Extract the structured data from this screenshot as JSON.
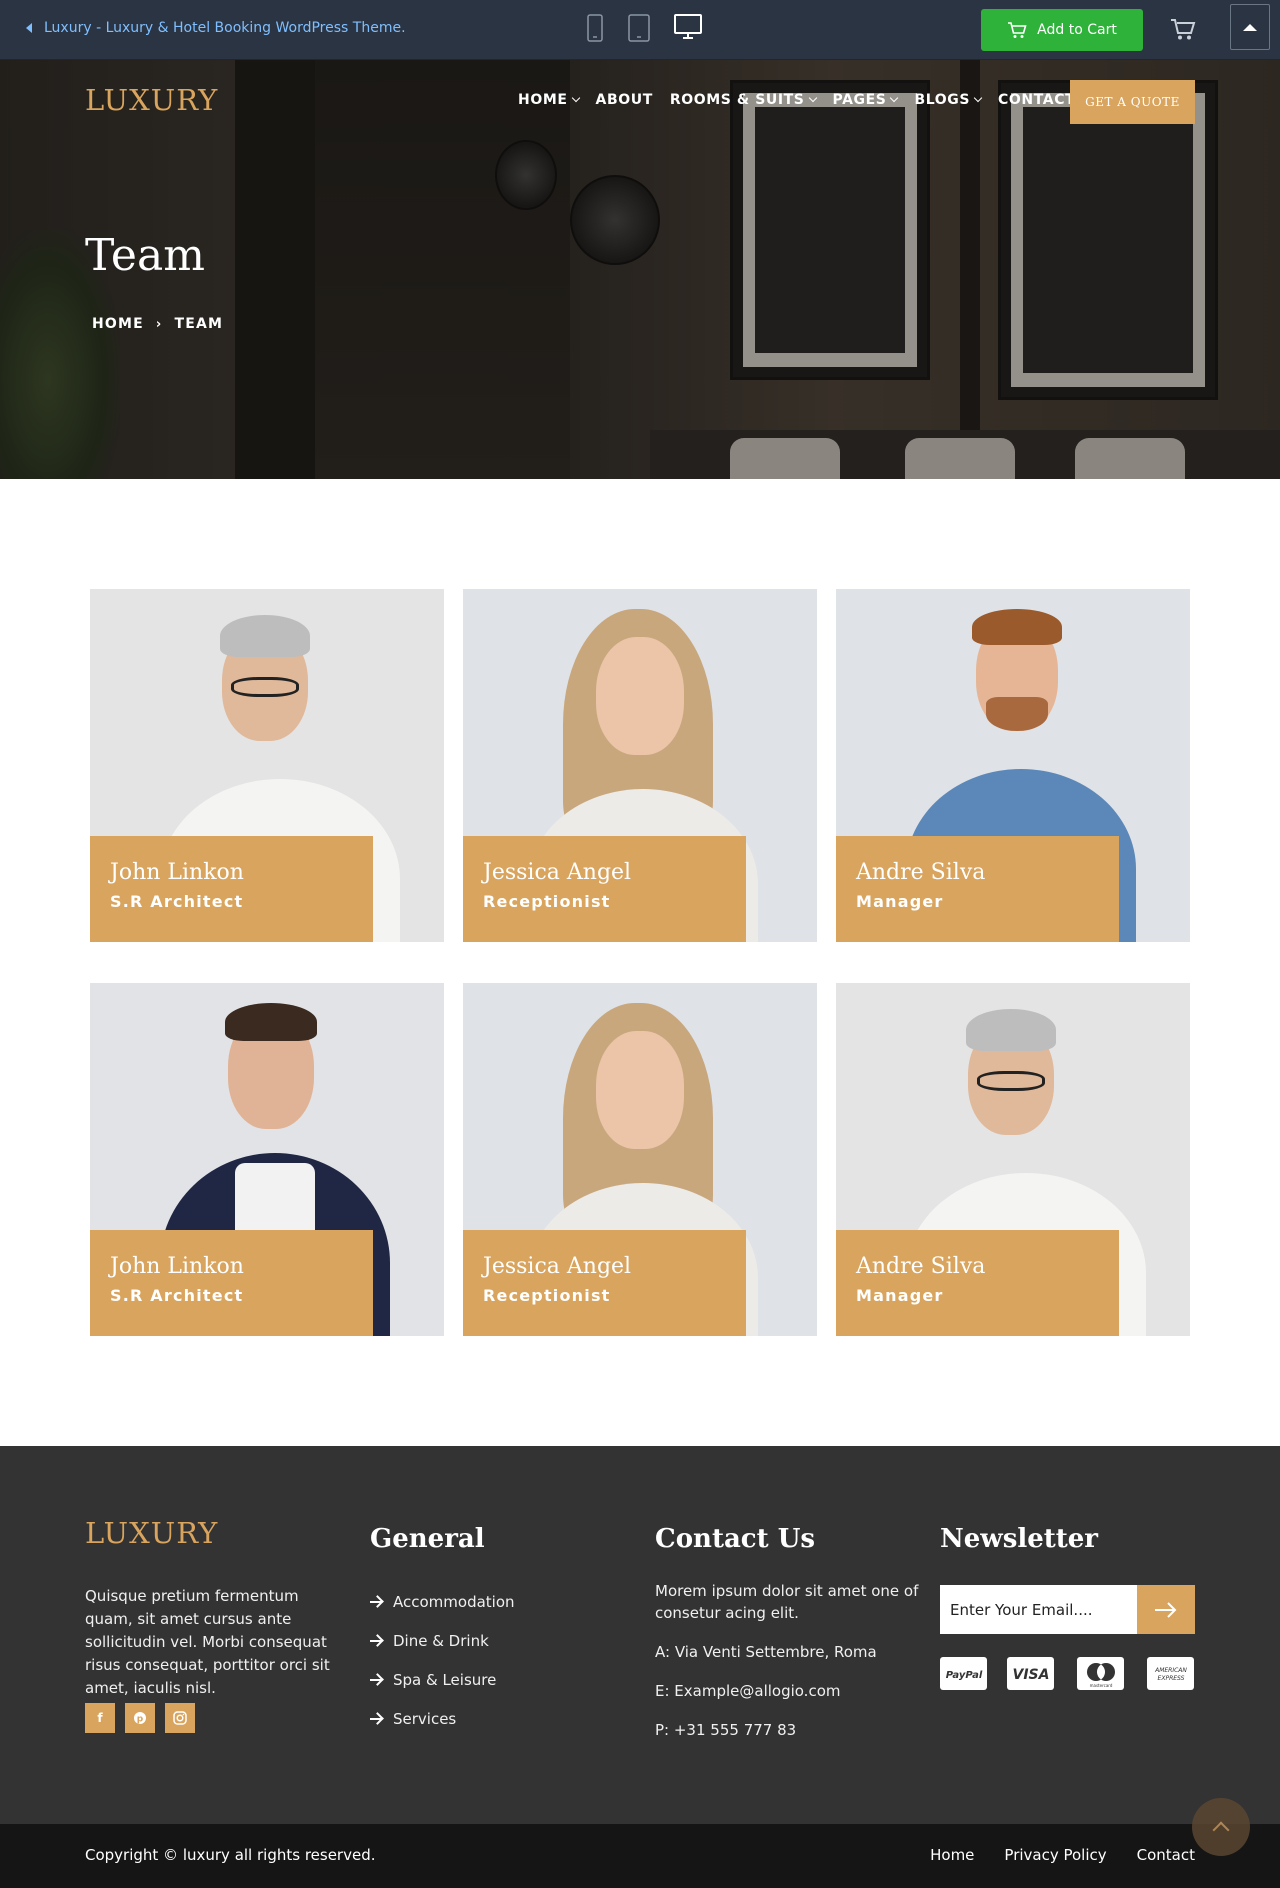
{
  "preview_bar": {
    "back_link": "Luxury - Luxury & Hotel Booking WordPress Theme.",
    "add_to_cart": "Add to Cart",
    "icons": [
      "mobile-icon",
      "tablet-icon",
      "desktop-icon",
      "cart-icon",
      "collapse-icon"
    ]
  },
  "header": {
    "logo": "LUXURY",
    "nav": [
      "HOME",
      "ABOUT",
      "ROOMS & SUITS",
      "PAGES",
      "BLOGS",
      "CONTACT"
    ],
    "quote_button": "GET A QUOTE"
  },
  "hero": {
    "title": "Team",
    "breadcrumb": [
      "HOME",
      "TEAM"
    ]
  },
  "team": [
    {
      "name": "John Linkon",
      "role": "S.R Architect"
    },
    {
      "name": "Jessica Angel",
      "role": "Receptionist"
    },
    {
      "name": "Andre Silva",
      "role": "Manager"
    },
    {
      "name": "John Linkon",
      "role": "S.R Architect"
    },
    {
      "name": "Jessica Angel",
      "role": "Receptionist"
    },
    {
      "name": "Andre Silva",
      "role": "Manager"
    }
  ],
  "footer": {
    "logo": "LUXURY",
    "about": "Quisque pretium fermentum quam, sit amet cursus ante sollicitudin vel. Morbi consequat risus consequat, porttitor orci sit amet, iaculis nisl.",
    "social": [
      "facebook-icon",
      "pinterest-icon",
      "instagram-icon"
    ],
    "general_title": "General",
    "general_links": [
      "Accommodation",
      "Dine & Drink",
      "Spa & Leisure",
      "Services"
    ],
    "contact_title": "Contact Us",
    "contact_text": "Morem ipsum dolor sit amet one of consetur acing elit.",
    "address": "A: Via Venti Settembre, Roma",
    "email": "E: Example@allogio.com",
    "phone": "P: +31 555 777 83",
    "newsletter_title": "Newsletter",
    "newsletter_placeholder": "Enter Your Email....",
    "payments": [
      "PayPal",
      "VISA",
      "mastercard",
      "AMERICAN EXPRESS"
    ]
  },
  "bottom_bar": {
    "copyright": "Copyright © luxury all rights reserved.",
    "links": [
      "Home",
      "Privacy Policy",
      "Contact"
    ]
  },
  "colors": {
    "accent": "#d9a45d",
    "preview_bar": "#2b3442",
    "add_to_cart": "#2fb23a",
    "footer": "#333333",
    "bottom_bar": "#151515"
  }
}
